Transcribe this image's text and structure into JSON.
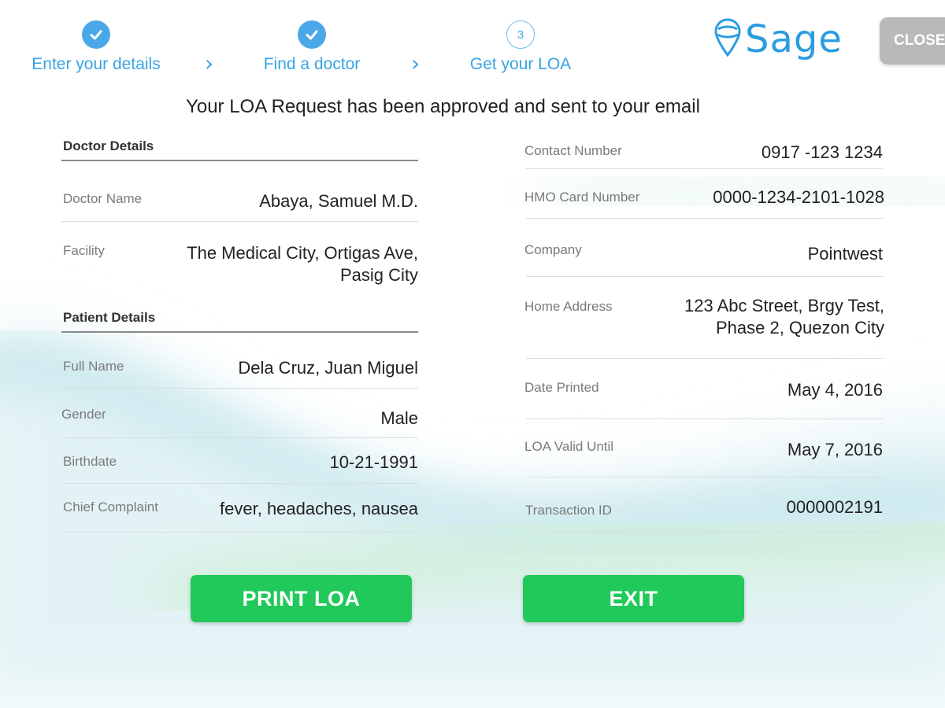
{
  "steps": [
    {
      "label": "Enter your details",
      "status": "done"
    },
    {
      "label": "Find a doctor",
      "status": "done"
    },
    {
      "label": "Get your LOA",
      "status": "current",
      "number": "3"
    }
  ],
  "logo": {
    "text": "Sage",
    "icon": "location-pin-icon"
  },
  "close_label": "CLOSE",
  "headline": "Your LOA Request has been approved and sent to your email",
  "doctor_details": {
    "title": "Doctor Details",
    "rows": [
      {
        "label": "Doctor Name",
        "value": "Abaya, Samuel M.D."
      },
      {
        "label": "Facility",
        "value": "The Medical City, Ortigas Ave,",
        "value2": "Pasig City"
      }
    ]
  },
  "patient_details": {
    "title": "Patient Details",
    "rows": [
      {
        "label": "Full Name",
        "value": "Dela Cruz, Juan Miguel"
      },
      {
        "label": "Gender",
        "value": "Male"
      },
      {
        "label": "Birthdate",
        "value": "10-21-1991"
      },
      {
        "label": "Chief Complaint",
        "value": "fever, headaches, nausea"
      }
    ]
  },
  "other_details": {
    "rows": [
      {
        "label": "Contact Number",
        "value": "0917 -123 1234"
      },
      {
        "label": "HMO Card Number",
        "value": "0000-1234-2101-1028"
      },
      {
        "label": "Company",
        "value": "Pointwest"
      },
      {
        "label": "Home Address",
        "value": "123 Abc Street, Brgy Test,",
        "value2": "Phase 2, Quezon City"
      },
      {
        "label": "Date Printed",
        "value": "May 4, 2016"
      },
      {
        "label": "LOA Valid Until",
        "value": "May 7, 2016"
      },
      {
        "label": "Transaction ID",
        "value": "0000002191"
      }
    ]
  },
  "buttons": {
    "print": "PRINT LOA",
    "exit": "EXIT"
  },
  "colors": {
    "accent_blue": "#3aa3e3",
    "button_green": "#20c95a",
    "close_gray": "#b9b9b9"
  }
}
